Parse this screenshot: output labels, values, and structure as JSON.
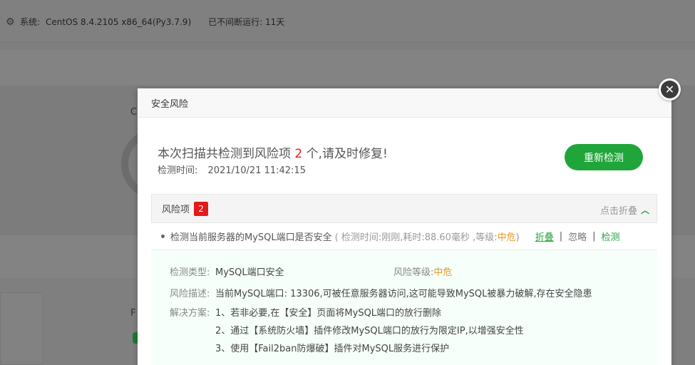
{
  "background": {
    "system_label": "系统:",
    "system_value": "CentOS 8.4.2105 x86_64(Py3.7.9)",
    "uptime": "已不间断运行: 11天"
  },
  "modal": {
    "title": "安全风险",
    "summary_prefix": "本次扫描共检测到风险项",
    "summary_count": "2",
    "summary_suffix": "个,请及时修复!",
    "scan_time_label": "检测时间:",
    "scan_time_value": "2021/10/21 11:42:15",
    "rescan_label": "重新检测",
    "risk_header": {
      "label": "风险项",
      "count": "2",
      "collapse_label": "点击折叠"
    },
    "items": [
      {
        "title": "检测当前服务器的MySQL端口是否安全",
        "meta_prefix": "( 检测时间:刚刚,耗时:88.60毫秒 ,等级:",
        "level": "中危",
        "meta_suffix": ")",
        "actions": {
          "fold": "折叠",
          "ignore": "忽略",
          "check": "检测"
        },
        "detail": {
          "type_label": "检测类型:",
          "type_value": "MySQL端口安全",
          "level_label": "风险等级:",
          "level_value": "中危",
          "desc_label": "风险描述:",
          "desc_value": "当前MySQL端口: 13306,可被任意服务器访问,这可能导致MySQL被暴力破解,存在安全隐患",
          "solution_label": "解决方案:",
          "solutions": [
            "1、若非必要,在【安全】页面将MySQL端口的放行删除",
            "2、通过【系统防火墙】插件修改MySQL端口的放行为限定IP,以增强安全性",
            "3、使用【Fail2ban防爆破】插件对MySQL服务进行保护"
          ]
        }
      }
    ]
  },
  "colors": {
    "accent_green": "#20a53a",
    "danger_red": "#e5211e",
    "warning_orange": "#e69822"
  }
}
